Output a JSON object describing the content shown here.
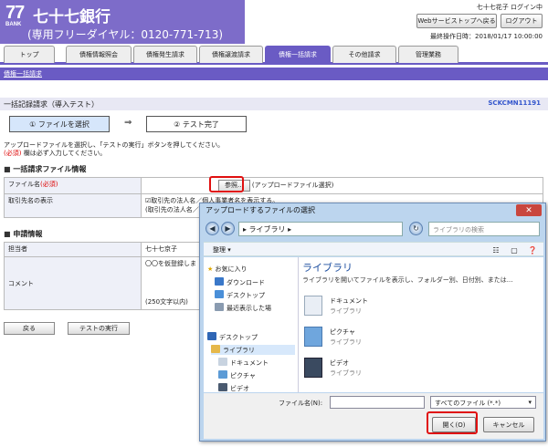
{
  "header": {
    "logo_num": "77",
    "logo_bank": "BANK",
    "bank_name": "七十七銀行",
    "freedial": "(専用フリーダイヤル：0120-771-713)",
    "user_status": "七十七花子 ログイン中",
    "web_button": "Webサービストップへ戻る",
    "logout_button": "ログアウト",
    "last_login": "最終操作日時：2018/01/17 10:00:00"
  },
  "tabs": [
    "トップ",
    "債権情報照会",
    "債権発生請求",
    "債権譲渡請求",
    "債権一括請求",
    "その他請求",
    "管理業務"
  ],
  "active_tab_index": 4,
  "subnav": {
    "link": "債権一括請求"
  },
  "page": {
    "title": "一括記録請求（導入テスト）",
    "screen_id": "SCKCMN11191",
    "steps": [
      "① ファイルを選択",
      "② テスト完了"
    ],
    "arrow": "⇒",
    "instruction": "アップロードファイルを選択し、「テストの実行」ボタンを押してください。",
    "required_mark": "(必須)",
    "required_note": " 欄は必ず入力してください。"
  },
  "section_file": {
    "heading": "一括請求ファイル情報",
    "file_label": "ファイル名",
    "file_required": "(必須)",
    "browse_button": "参照...",
    "browse_hint": "(アップロードファイル選択)",
    "name_label": "取引先名の表示",
    "name_option1": "取引先の法人名／個人事業者名を表示する。",
    "name_option2": "(取引先の法人名／"
  },
  "section_apply": {
    "heading": "申請情報",
    "person_label": "担当者",
    "person_value": "七十七京子",
    "comment_label": "コメント",
    "comment_value": "〇〇を仮登録しま",
    "comment_limit": "(250文字以内)"
  },
  "buttons": {
    "back": "戻る",
    "run": "テストの実行"
  },
  "dialog": {
    "title": "アップロードするファイルの選択",
    "close": "✕",
    "path": "▸ ライブラリ ▸",
    "search_placeholder": "ライブラリの検索",
    "organize": "整理 ▾",
    "nav_items": [
      "お気に入り",
      "ダウンロード",
      "デスクトップ",
      "最近表示した場",
      "デスクトップ",
      "ライブラリ",
      "ドキュメント",
      "ピクチャ",
      "ビデオ"
    ],
    "lib_title": "ライブラリ",
    "lib_desc": "ライブラリを開いてファイルを表示し、フォルダー別、日付別、または...",
    "lib_items": [
      {
        "name": "ドキュメント",
        "sub": "ライブラリ"
      },
      {
        "name": "ピクチャ",
        "sub": "ライブラリ"
      },
      {
        "name": "ビデオ",
        "sub": "ライブラリ"
      }
    ],
    "filename_label": "ファイル名(N):",
    "filetype": "すべてのファイル (*.*)",
    "open_button": "開く(O)",
    "cancel_button": "キャンセル"
  }
}
